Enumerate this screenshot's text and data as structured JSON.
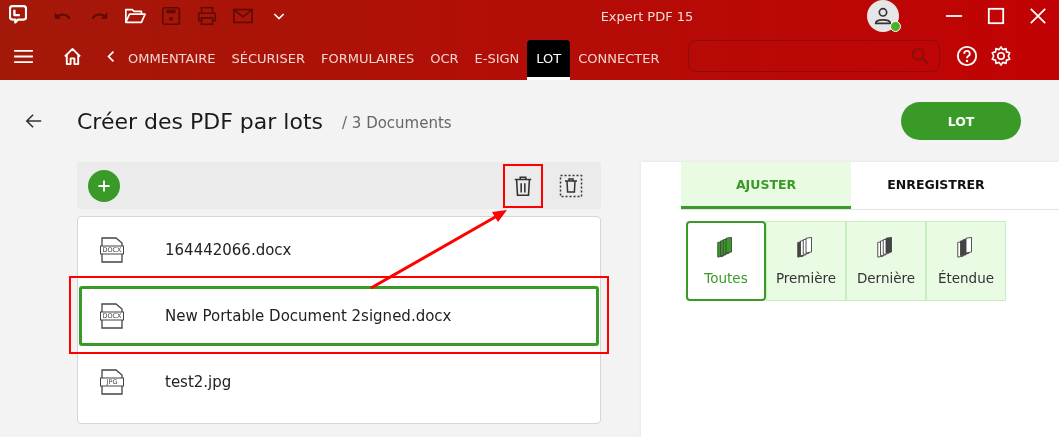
{
  "window": {
    "title": "Expert PDF 15",
    "user_online": true
  },
  "quick_toolbar": [
    {
      "kind": "undo",
      "disabled": true
    },
    {
      "kind": "redo",
      "disabled": true
    },
    {
      "kind": "open",
      "disabled": false
    },
    {
      "kind": "save",
      "disabled": true
    },
    {
      "kind": "print",
      "disabled": true
    },
    {
      "kind": "mail",
      "disabled": true
    },
    {
      "kind": "more",
      "disabled": false
    }
  ],
  "ribbon_tabs": [
    {
      "label": "OMMENTAIRE",
      "selected": false
    },
    {
      "label": "SÉCURISER",
      "selected": false
    },
    {
      "label": "FORMULAIRES",
      "selected": false
    },
    {
      "label": "OCR",
      "selected": false
    },
    {
      "label": "E-SIGN",
      "selected": false
    },
    {
      "label": "LOT",
      "selected": true
    },
    {
      "label": "CONNECTER",
      "selected": false
    }
  ],
  "page": {
    "title": "Créer des PDF par lots",
    "subtitle": "/ 3 Documents",
    "action_button": "LOT"
  },
  "file_toolbar": {
    "delete_highlighted": true
  },
  "files": [
    {
      "type_label": "DOCX",
      "name": "164442066.docx",
      "selected": false,
      "highlighted": false
    },
    {
      "type_label": "DOCX",
      "name": "New Portable Document 2signed.docx",
      "selected": true,
      "highlighted": true
    },
    {
      "type_label": "JPG",
      "name": "test2.jpg",
      "selected": false,
      "highlighted": false
    }
  ],
  "settings_tabs": [
    {
      "label": "AJUSTER",
      "selected": true
    },
    {
      "label": "ENREGISTRER",
      "selected": false
    }
  ],
  "page_options": [
    {
      "kind": "all",
      "label": "Toutes",
      "selected": true
    },
    {
      "kind": "first",
      "label": "Première",
      "selected": false
    },
    {
      "kind": "last",
      "label": "Dernière",
      "selected": false
    },
    {
      "kind": "range",
      "label": "Étendue",
      "selected": false
    }
  ]
}
